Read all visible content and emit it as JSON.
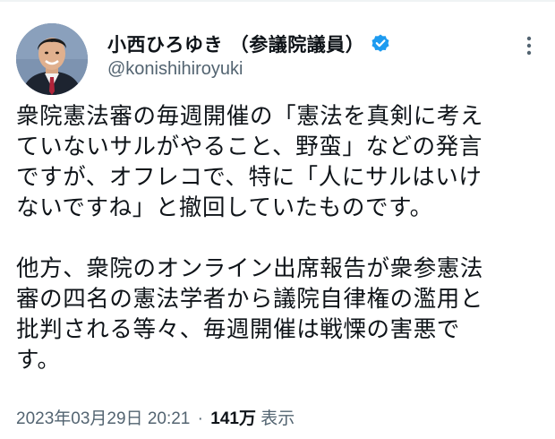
{
  "author": {
    "display_name": "小西ひろゆき （参議院議員）",
    "handle": "@konishihiroyuki",
    "verified": true
  },
  "tweet": {
    "lines_p1": [
      "衆院憲法審の毎週開催の「憲法を真剣に考え",
      "ていないサルがやること、野蛮」などの発言",
      "ですが、オフレコで、特に「人にサルはいけ",
      "ないですね」と撤回していたものです。"
    ],
    "lines_p2": [
      "他方、衆院のオンライン出席報告が衆参憲法",
      "審の四名の憲法学者から議院自律権の濫用と",
      "批判される等々、毎週開催は戦慄の害悪で",
      "す。"
    ]
  },
  "meta": {
    "timestamp": "2023年03月29日 20:21",
    "separator": "·",
    "views_count": "141万",
    "views_label": "表示"
  },
  "icons": {
    "verified": "verified-badge-icon",
    "more": "more-options-icon"
  },
  "colors": {
    "verified_blue": "#1d9bf0",
    "secondary_text": "#536471",
    "primary_text": "#0f1419"
  }
}
